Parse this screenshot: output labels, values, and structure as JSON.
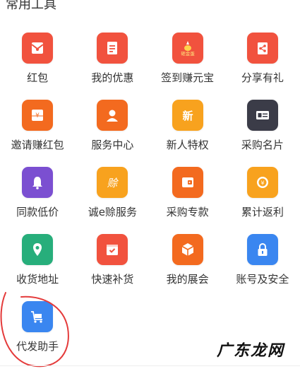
{
  "section": {
    "title": "常用工具"
  },
  "items": [
    {
      "label": "红包",
      "icon": "red-envelope-icon",
      "color": "#F1523E"
    },
    {
      "label": "我的优惠",
      "icon": "coupon-icon",
      "color": "#F1523E"
    },
    {
      "label": "签到赚元宝",
      "icon": "ingot-icon",
      "color": "#F1523E",
      "glyph": "砸金蛋"
    },
    {
      "label": "分享有礼",
      "icon": "share-icon",
      "color": "#F1523E"
    },
    {
      "label": "邀请赚红包",
      "icon": "invite-envelope-icon",
      "color": "#F36A1F"
    },
    {
      "label": "服务中心",
      "icon": "service-person-icon",
      "color": "#F36A1F"
    },
    {
      "label": "新人特权",
      "icon": "new-badge-icon",
      "color": "#F8A21E",
      "glyph": "新"
    },
    {
      "label": "采购名片",
      "icon": "business-card-icon",
      "color": "#3B3C48"
    },
    {
      "label": "同款低价",
      "icon": "bell-icon",
      "color": "#7B4FD1"
    },
    {
      "label": "诚e赊服务",
      "icon": "credit-icon",
      "color": "#F8A21E",
      "glyph": "赊"
    },
    {
      "label": "采购专款",
      "icon": "wallet-icon",
      "color": "#F36A1F"
    },
    {
      "label": "累计返利",
      "icon": "coin-icon",
      "color": "#F8A21E"
    },
    {
      "label": "收货地址",
      "icon": "location-pin-icon",
      "color": "#27AE7B"
    },
    {
      "label": "快速补货",
      "icon": "restock-box-icon",
      "color": "#F1523E"
    },
    {
      "label": "我的展会",
      "icon": "cube-icon",
      "color": "#F36A1F"
    },
    {
      "label": "账号及安全",
      "icon": "lock-icon",
      "color": "#3A86F0"
    },
    {
      "label": "代发助手",
      "icon": "cart-icon",
      "color": "#3A86F0"
    }
  ],
  "watermark": {
    "text": "广东龙网"
  },
  "annotation_color": "#E43B3B"
}
